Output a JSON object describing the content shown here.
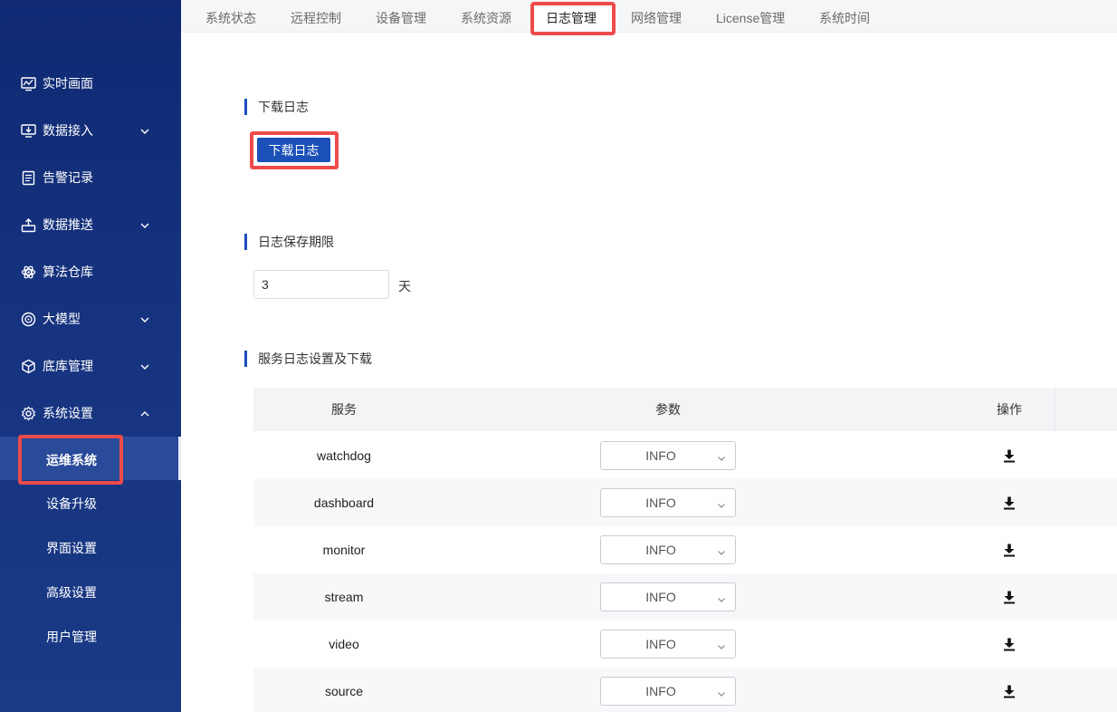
{
  "sidebar": {
    "items": [
      {
        "label": "实时画面",
        "icon": "chart-monitor-icon",
        "expandable": false
      },
      {
        "label": "数据接入",
        "icon": "monitor-download-icon",
        "expandable": true
      },
      {
        "label": "告警记录",
        "icon": "document-list-icon",
        "expandable": false
      },
      {
        "label": "数据推送",
        "icon": "upload-tray-icon",
        "expandable": true
      },
      {
        "label": "算法仓库",
        "icon": "atom-icon",
        "expandable": false
      },
      {
        "label": "大模型",
        "icon": "gear-circle-icon",
        "expandable": true
      },
      {
        "label": "底库管理",
        "icon": "cube-icon",
        "expandable": true
      },
      {
        "label": "系统设置",
        "icon": "gear-icon",
        "expandable": true,
        "expanded": true
      }
    ],
    "subitems": [
      {
        "label": "运维系统",
        "active": true
      },
      {
        "label": "设备升级"
      },
      {
        "label": "界面设置"
      },
      {
        "label": "高级设置"
      },
      {
        "label": "用户管理"
      }
    ]
  },
  "tabs": [
    {
      "label": "系统状态"
    },
    {
      "label": "远程控制"
    },
    {
      "label": "设备管理"
    },
    {
      "label": "系统资源"
    },
    {
      "label": "日志管理",
      "active": true
    },
    {
      "label": "网络管理"
    },
    {
      "label": "License管理"
    },
    {
      "label": "系统时间"
    }
  ],
  "download_section": {
    "title": "下载日志",
    "button_label": "下载日志"
  },
  "retention_section": {
    "title": "日志保存期限",
    "value": "3",
    "unit": "天"
  },
  "service_section": {
    "title": "服务日志设置及下载",
    "headers": {
      "service": "服务",
      "param": "参数",
      "action": "操作"
    },
    "rows": [
      {
        "service": "watchdog",
        "level": "INFO"
      },
      {
        "service": "dashboard",
        "level": "INFO"
      },
      {
        "service": "monitor",
        "level": "INFO"
      },
      {
        "service": "stream",
        "level": "INFO"
      },
      {
        "service": "video",
        "level": "INFO"
      },
      {
        "service": "source",
        "level": "INFO"
      }
    ]
  },
  "colors": {
    "primary": "#1c50b9",
    "sidebar": "#16337f",
    "highlight": "#ee4b4b"
  }
}
